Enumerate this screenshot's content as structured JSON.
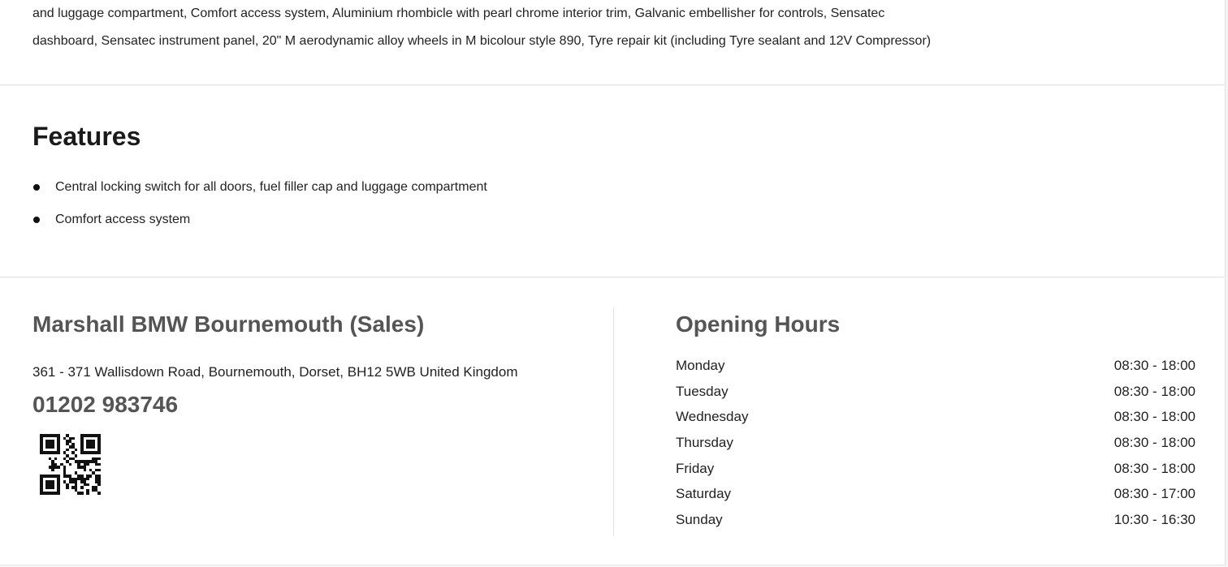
{
  "spec": {
    "line1": "and luggage compartment, Comfort access system, Aluminium rhombicle with pearl chrome interior trim, Galvanic embellisher for controls, Sensatec",
    "line2": "dashboard, Sensatec instrument panel, 20\" M aerodynamic alloy wheels in M bicolour style 890, Tyre repair kit (including Tyre sealant and 12V Compressor)"
  },
  "features": {
    "title": "Features",
    "items": [
      "Central locking switch for all doors, fuel filler cap and luggage compartment",
      "Comfort access system"
    ]
  },
  "dealer": {
    "name": "Marshall BMW Bournemouth (Sales)",
    "address": "361 - 371 Wallisdown Road, Bournemouth, Dorset, BH12 5WB United Kingdom",
    "phone": "01202 983746",
    "qr_icon": "qr-code-icon"
  },
  "hours": {
    "title": "Opening Hours",
    "rows": [
      {
        "day": "Monday",
        "time": "08:30 - 18:00"
      },
      {
        "day": "Tuesday",
        "time": "08:30 - 18:00"
      },
      {
        "day": "Wednesday",
        "time": "08:30 - 18:00"
      },
      {
        "day": "Thursday",
        "time": "08:30 - 18:00"
      },
      {
        "day": "Friday",
        "time": "08:30 - 18:00"
      },
      {
        "day": "Saturday",
        "time": "08:30 - 17:00"
      },
      {
        "day": "Sunday",
        "time": "10:30 - 16:30"
      }
    ]
  },
  "colors": {
    "background": "#f4f4f4",
    "panel": "#ffffff",
    "heading_gray": "#555555",
    "text": "#222222"
  }
}
